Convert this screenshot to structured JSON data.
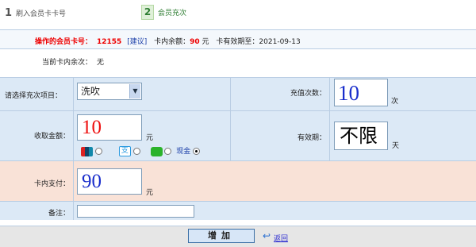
{
  "steps": [
    {
      "num": "1",
      "label": "刷入会员卡卡号"
    },
    {
      "num": "2",
      "label": "会员充次"
    }
  ],
  "info": {
    "card_label": "操作的会员卡号：",
    "card_number": "12155",
    "suggest_link": "[建议]",
    "balance_label": "卡内余额：",
    "balance_value": "90",
    "balance_unit": "元",
    "expiry_label": "卡有效期至：",
    "expiry_value": "2021-09-13"
  },
  "remaining": {
    "label": "当前卡内余次：",
    "value": "无"
  },
  "form": {
    "project_label": "请选择充次项目：",
    "project_value": "洗吹",
    "count_label": "充值次数：",
    "count_value": "10",
    "count_unit": "次",
    "amount_label": "收取金额：",
    "amount_value": "10",
    "amount_unit": "元",
    "cash_label": "现金",
    "validity_label": "有效期：",
    "validity_value": "不限",
    "validity_unit": "天",
    "card_pay_label": "卡内支付：",
    "card_pay_value": "90",
    "card_pay_unit": "元",
    "note_label": "备注：",
    "note_value": ""
  },
  "actions": {
    "add_label": "增加",
    "back_label": "返回"
  },
  "colors": {
    "accent_red": "#ee0000",
    "input_blue": "#1a2ecc",
    "input_red": "#ee1111"
  }
}
